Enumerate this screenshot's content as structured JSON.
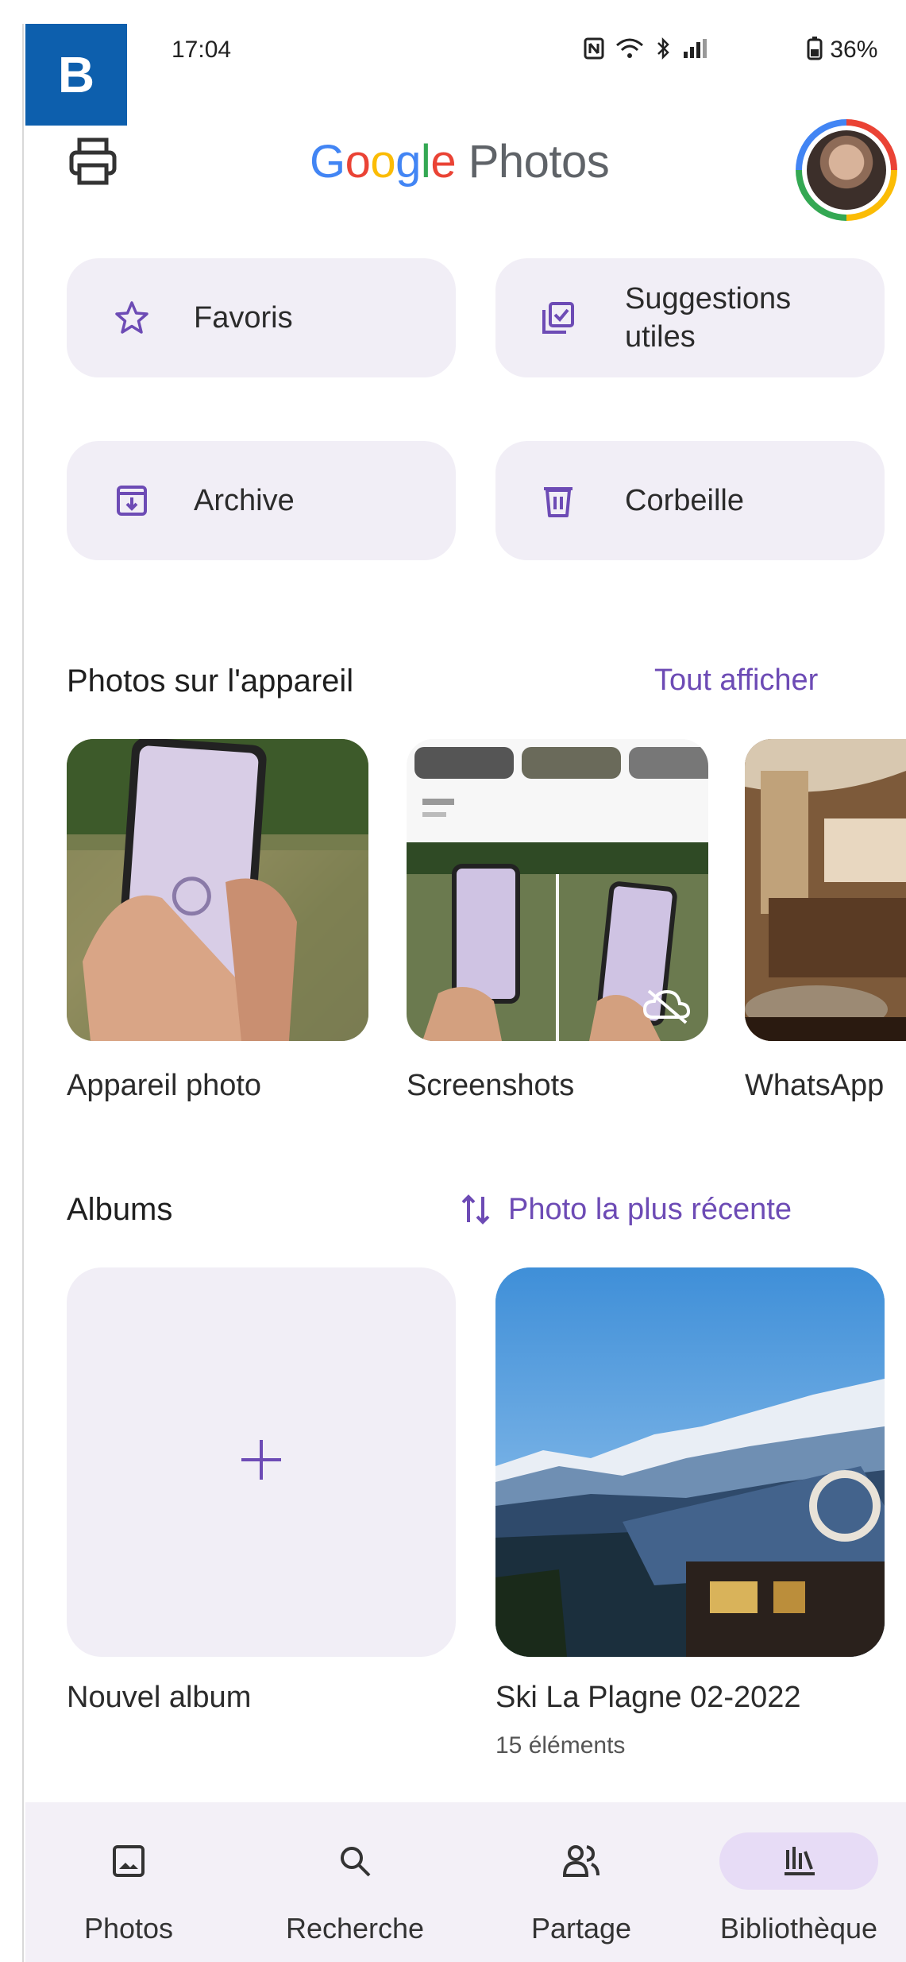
{
  "badge": "B",
  "status_bar": {
    "time": "17:04",
    "battery": "36%",
    "icons": [
      "nfc-icon",
      "wifi-calling-icon",
      "bluetooth-icon",
      "signal-icon",
      "battery-icon"
    ]
  },
  "header": {
    "title_google": [
      "G",
      "o",
      "o",
      "g",
      "l",
      "e"
    ],
    "title_photos": "Photos"
  },
  "quick_tiles": [
    {
      "label": "Favoris",
      "icon": "star-icon"
    },
    {
      "label": "Suggestions\nutiles",
      "label_line1": "Suggestions",
      "label_line2": "utiles",
      "icon": "suggestions-icon"
    },
    {
      "label": "Archive",
      "icon": "archive-icon"
    },
    {
      "label": "Corbeille",
      "icon": "trash-icon"
    }
  ],
  "device_photos": {
    "title": "Photos sur l'appareil",
    "link": "Tout afficher",
    "folders": [
      "Appareil photo",
      "Screenshots",
      "WhatsApp"
    ]
  },
  "albums": {
    "title": "Albums",
    "sort_label": "Photo la plus récente",
    "items": [
      {
        "label": "Nouvel album"
      },
      {
        "label": "Ski La Plagne 02-2022",
        "sub": "15 éléments"
      }
    ]
  },
  "bottom_nav": [
    {
      "label": "Photos",
      "icon": "photo-icon"
    },
    {
      "label": "Recherche",
      "icon": "search-icon"
    },
    {
      "label": "Partage",
      "icon": "people-icon"
    },
    {
      "label": "Bibliothèque",
      "icon": "library-icon",
      "active": true
    }
  ],
  "colors": {
    "accent": "#6d4bb5",
    "tile_bg": "#f1eef6",
    "badge_bg": "#0d5fad",
    "nav_bg": "#f3f0f7",
    "active_pill": "#e7dcf6"
  }
}
